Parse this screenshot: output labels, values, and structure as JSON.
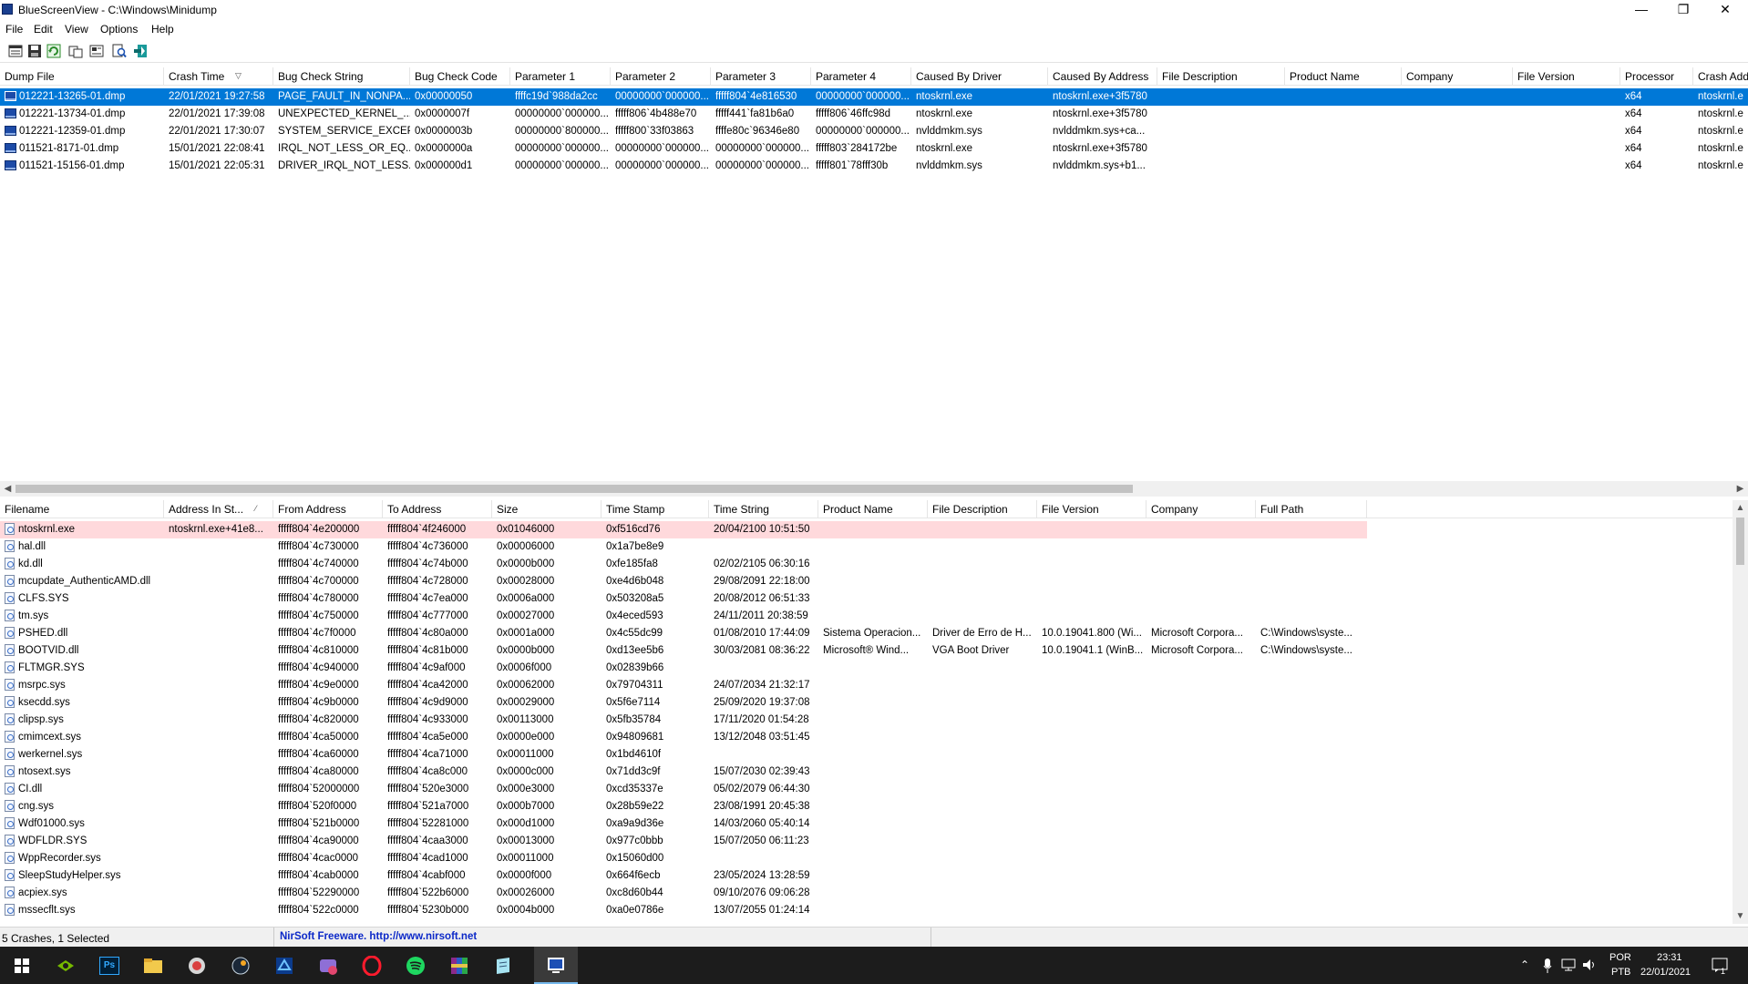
{
  "window": {
    "title": "BlueScreenView  -  C:\\Windows\\Minidump",
    "minimize": "—",
    "maximize": "❐",
    "close": "✕"
  },
  "menu": [
    "File",
    "Edit",
    "View",
    "Options",
    "Help"
  ],
  "toolbar": [
    "properties-icon",
    "save-icon",
    "refresh-icon",
    "copy-icon",
    "html-report-icon",
    "find-icon",
    "exit-icon"
  ],
  "top_table": {
    "columns": [
      "Dump File",
      "Crash Time",
      "Bug Check String",
      "Bug Check Code",
      "Parameter 1",
      "Parameter 2",
      "Parameter 3",
      "Parameter 4",
      "Caused By Driver",
      "Caused By Address",
      "File Description",
      "Product Name",
      "Company",
      "File Version",
      "Processor",
      "Crash Add"
    ],
    "rows": [
      [
        "012221-13265-01.dmp",
        "22/01/2021 19:27:58",
        "PAGE_FAULT_IN_NONPA...",
        "0x00000050",
        "ffffc19d`988da2cc",
        "00000000`000000...",
        "fffff804`4e816530",
        "00000000`000000...",
        "ntoskrnl.exe",
        "ntoskrnl.exe+3f5780",
        "",
        "",
        "",
        "",
        "x64",
        "ntoskrnl.e"
      ],
      [
        "012221-13734-01.dmp",
        "22/01/2021 17:39:08",
        "UNEXPECTED_KERNEL_...",
        "0x0000007f",
        "00000000`000000...",
        "fffff806`4b488e70",
        "fffff441`fa81b6a0",
        "fffff806`46ffc98d",
        "ntoskrnl.exe",
        "ntoskrnl.exe+3f5780",
        "",
        "",
        "",
        "",
        "x64",
        "ntoskrnl.e"
      ],
      [
        "012221-12359-01.dmp",
        "22/01/2021 17:30:07",
        "SYSTEM_SERVICE_EXCEP...",
        "0x0000003b",
        "00000000`800000...",
        "fffff800`33f03863",
        "ffffe80c`96346e80",
        "00000000`000000...",
        "nvlddmkm.sys",
        "nvlddmkm.sys+ca...",
        "",
        "",
        "",
        "",
        "x64",
        "ntoskrnl.e"
      ],
      [
        "011521-8171-01.dmp",
        "15/01/2021 22:08:41",
        "IRQL_NOT_LESS_OR_EQ...",
        "0x0000000a",
        "00000000`000000...",
        "00000000`000000...",
        "00000000`000000...",
        "fffff803`284172be",
        "ntoskrnl.exe",
        "ntoskrnl.exe+3f5780",
        "",
        "",
        "",
        "",
        "x64",
        "ntoskrnl.e"
      ],
      [
        "011521-15156-01.dmp",
        "15/01/2021 22:05:31",
        "DRIVER_IRQL_NOT_LESS...",
        "0x000000d1",
        "00000000`000000...",
        "00000000`000000...",
        "00000000`000000...",
        "fffff801`78fff30b",
        "nvlddmkm.sys",
        "nvlddmkm.sys+b1...",
        "",
        "",
        "",
        "",
        "x64",
        "ntoskrnl.e"
      ]
    ]
  },
  "bottom_table": {
    "columns": [
      "Filename",
      "Address In St...",
      "From Address",
      "To Address",
      "Size",
      "Time Stamp",
      "Time String",
      "Product Name",
      "File Description",
      "File Version",
      "Company",
      "Full Path"
    ],
    "rows": [
      [
        "ntoskrnl.exe",
        "ntoskrnl.exe+41e8...",
        "fffff804`4e200000",
        "fffff804`4f246000",
        "0x01046000",
        "0xf516cd76",
        "20/04/2100 10:51:50",
        "",
        "",
        "",
        "",
        ""
      ],
      [
        "hal.dll",
        "",
        "fffff804`4c730000",
        "fffff804`4c736000",
        "0x00006000",
        "0x1a7be8e9",
        "",
        "",
        "",
        "",
        "",
        ""
      ],
      [
        "kd.dll",
        "",
        "fffff804`4c740000",
        "fffff804`4c74b000",
        "0x0000b000",
        "0xfe185fa8",
        "02/02/2105 06:30:16",
        "",
        "",
        "",
        "",
        ""
      ],
      [
        "mcupdate_AuthenticAMD.dll",
        "",
        "fffff804`4c700000",
        "fffff804`4c728000",
        "0x00028000",
        "0xe4d6b048",
        "29/08/2091 22:18:00",
        "",
        "",
        "",
        "",
        ""
      ],
      [
        "CLFS.SYS",
        "",
        "fffff804`4c780000",
        "fffff804`4c7ea000",
        "0x0006a000",
        "0x503208a5",
        "20/08/2012 06:51:33",
        "",
        "",
        "",
        "",
        ""
      ],
      [
        "tm.sys",
        "",
        "fffff804`4c750000",
        "fffff804`4c777000",
        "0x00027000",
        "0x4eced593",
        "24/11/2011 20:38:59",
        "",
        "",
        "",
        "",
        ""
      ],
      [
        "PSHED.dll",
        "",
        "fffff804`4c7f0000",
        "fffff804`4c80a000",
        "0x0001a000",
        "0x4c55dc99",
        "01/08/2010 17:44:09",
        "Sistema Operacion...",
        "Driver de Erro de H...",
        "10.0.19041.800 (Wi...",
        "Microsoft Corpora...",
        "C:\\Windows\\syste..."
      ],
      [
        "BOOTVID.dll",
        "",
        "fffff804`4c810000",
        "fffff804`4c81b000",
        "0x0000b000",
        "0xd13ee5b6",
        "30/03/2081 08:36:22",
        "Microsoft® Wind...",
        "VGA Boot Driver",
        "10.0.19041.1 (WinB...",
        "Microsoft Corpora...",
        "C:\\Windows\\syste..."
      ],
      [
        "FLTMGR.SYS",
        "",
        "fffff804`4c940000",
        "fffff804`4c9af000",
        "0x0006f000",
        "0x02839b66",
        "",
        "",
        "",
        "",
        "",
        ""
      ],
      [
        "msrpc.sys",
        "",
        "fffff804`4c9e0000",
        "fffff804`4ca42000",
        "0x00062000",
        "0x79704311",
        "24/07/2034 21:32:17",
        "",
        "",
        "",
        "",
        ""
      ],
      [
        "ksecdd.sys",
        "",
        "fffff804`4c9b0000",
        "fffff804`4c9d9000",
        "0x00029000",
        "0x5f6e7114",
        "25/09/2020 19:37:08",
        "",
        "",
        "",
        "",
        ""
      ],
      [
        "clipsp.sys",
        "",
        "fffff804`4c820000",
        "fffff804`4c933000",
        "0x00113000",
        "0x5fb35784",
        "17/11/2020 01:54:28",
        "",
        "",
        "",
        "",
        ""
      ],
      [
        "cmimcext.sys",
        "",
        "fffff804`4ca50000",
        "fffff804`4ca5e000",
        "0x0000e000",
        "0x94809681",
        "13/12/2048 03:51:45",
        "",
        "",
        "",
        "",
        ""
      ],
      [
        "werkernel.sys",
        "",
        "fffff804`4ca60000",
        "fffff804`4ca71000",
        "0x00011000",
        "0x1bd4610f",
        "",
        "",
        "",
        "",
        "",
        ""
      ],
      [
        "ntosext.sys",
        "",
        "fffff804`4ca80000",
        "fffff804`4ca8c000",
        "0x0000c000",
        "0x71dd3c9f",
        "15/07/2030 02:39:43",
        "",
        "",
        "",
        "",
        ""
      ],
      [
        "CI.dll",
        "",
        "fffff804`52000000",
        "fffff804`520e3000",
        "0x000e3000",
        "0xcd35337e",
        "05/02/2079 06:44:30",
        "",
        "",
        "",
        "",
        ""
      ],
      [
        "cng.sys",
        "",
        "fffff804`520f0000",
        "fffff804`521a7000",
        "0x000b7000",
        "0x28b59e22",
        "23/08/1991 20:45:38",
        "",
        "",
        "",
        "",
        ""
      ],
      [
        "Wdf01000.sys",
        "",
        "fffff804`521b0000",
        "fffff804`52281000",
        "0x000d1000",
        "0xa9a9d36e",
        "14/03/2060 05:40:14",
        "",
        "",
        "",
        "",
        ""
      ],
      [
        "WDFLDR.SYS",
        "",
        "fffff804`4ca90000",
        "fffff804`4caa3000",
        "0x00013000",
        "0x977c0bbb",
        "15/07/2050 06:11:23",
        "",
        "",
        "",
        "",
        ""
      ],
      [
        "WppRecorder.sys",
        "",
        "fffff804`4cac0000",
        "fffff804`4cad1000",
        "0x00011000",
        "0x15060d00",
        "",
        "",
        "",
        "",
        "",
        ""
      ],
      [
        "SleepStudyHelper.sys",
        "",
        "fffff804`4cab0000",
        "fffff804`4cabf000",
        "0x0000f000",
        "0x664f6ecb",
        "23/05/2024 13:28:59",
        "",
        "",
        "",
        "",
        ""
      ],
      [
        "acpiex.sys",
        "",
        "fffff804`52290000",
        "fffff804`522b6000",
        "0x00026000",
        "0xc8d60b44",
        "09/10/2076 09:06:28",
        "",
        "",
        "",
        "",
        ""
      ],
      [
        "mssecflt.sys",
        "",
        "fffff804`522c0000",
        "fffff804`5230b000",
        "0x0004b000",
        "0xa0e0786e",
        "13/07/2055 01:24:14",
        "",
        "",
        "",
        "",
        ""
      ]
    ]
  },
  "status": {
    "count": "5 Crashes, 1 Selected",
    "nirsoft": "NirSoft Freeware.  http://www.nirsoft.net"
  },
  "taskbar": {
    "apps": [
      "windows-start-icon",
      "nvidia-icon",
      "photoshop-icon",
      "file-explorer-icon",
      "app-icon",
      "steam-icon",
      "bluescreenview-icon",
      "media-app-icon",
      "opera-icon",
      "spotify-icon",
      "winrar-icon",
      "notepad-icon",
      "bluescreenview-active-icon"
    ],
    "lang_top": "POR",
    "lang_bottom": "PTB",
    "time": "23:31",
    "date": "22/01/2021",
    "notif_count": "1"
  },
  "colors": {
    "selection": "#0078d7",
    "highlight_row": "#ffd9dc",
    "nirsoft_link": "#0b28c8",
    "taskbar": "#1c1c1c"
  }
}
